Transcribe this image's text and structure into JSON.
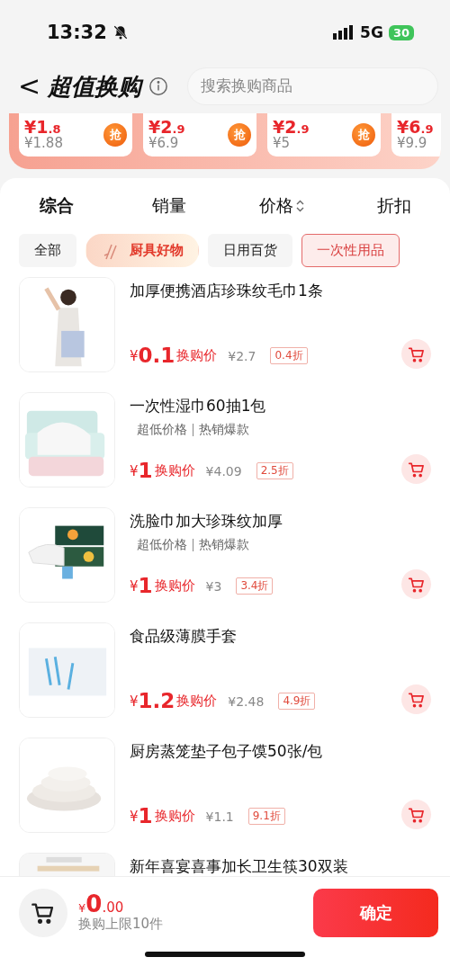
{
  "status_bar": {
    "time": "13:32",
    "network": "5G",
    "battery": "30"
  },
  "header": {
    "back": "<",
    "title": "超值换购",
    "search_placeholder": "搜索换购商品"
  },
  "deals": [
    {
      "price_int": "¥1",
      "price_dec": ".8",
      "original": "¥1.88",
      "grab": "抢"
    },
    {
      "price_int": "¥2",
      "price_dec": ".9",
      "original": "¥6.9",
      "grab": "抢"
    },
    {
      "price_int": "¥2",
      "price_dec": ".9",
      "original": "¥5",
      "grab": "抢"
    },
    {
      "price_int": "¥6",
      "price_dec": ".9",
      "original": "¥9.9"
    }
  ],
  "sort_tabs": [
    {
      "label": "综合",
      "selected": true
    },
    {
      "label": "销量",
      "selected": false
    },
    {
      "label": "价格",
      "selected": false,
      "kind": "sortable"
    },
    {
      "label": "折扣",
      "selected": false
    }
  ],
  "categories": [
    {
      "label": "全部",
      "kind": "plain",
      "selected": false
    },
    {
      "label": "厨具好物",
      "kind": "featured",
      "selected": false
    },
    {
      "label": "日用百货",
      "kind": "plain",
      "selected": false
    },
    {
      "label": "一次性用品",
      "kind": "plain",
      "selected": true
    }
  ],
  "products": [
    {
      "title": "加厚便携酒店珍珠纹毛巾1条",
      "currency": "¥",
      "price": "0.1",
      "price_label": "换购价",
      "original": "¥2.7",
      "discount": "0.4折"
    },
    {
      "title": "一次性湿巾60抽1包",
      "tags": [
        "超低价格",
        "热销爆款"
      ],
      "currency": "¥",
      "price": "1",
      "price_label": "换购价",
      "original": "¥4.09",
      "discount": "2.5折"
    },
    {
      "title": "洗脸巾加大珍珠纹加厚",
      "tags": [
        "超低价格",
        "热销爆款"
      ],
      "currency": "¥",
      "price": "1",
      "price_label": "换购价",
      "original": "¥3",
      "discount": "3.4折"
    },
    {
      "title": "食品级薄膜手套",
      "currency": "¥",
      "price": "1.2",
      "price_label": "换购价",
      "original": "¥2.48",
      "discount": "4.9折"
    },
    {
      "title": "厨房蒸笼垫子包子馍50张/包",
      "currency": "¥",
      "price": "1",
      "price_label": "换购价",
      "original": "¥1.1",
      "discount": "9.1折"
    },
    {
      "title": "新年喜宴喜事加长卫生筷30双装"
    }
  ],
  "footer": {
    "currency": "¥",
    "total_int": "0",
    "total_dec": ".00",
    "limit": "换购上限10件",
    "confirm": "确定"
  }
}
